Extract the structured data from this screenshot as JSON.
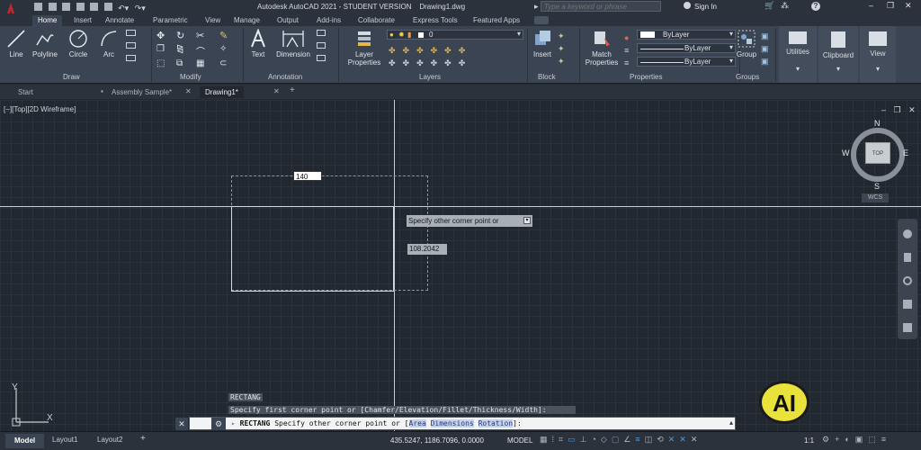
{
  "titlebar": {
    "title": "Autodesk AutoCAD 2021 - STUDENT VERSION    Drawing1.dwg",
    "search_placeholder": "Type a keyword or phrase",
    "sign_in": "Sign In"
  },
  "ribbon_tabs": [
    "Home",
    "Insert",
    "Annotate",
    "Parametric",
    "View",
    "Manage",
    "Output",
    "Add-ins",
    "Collaborate",
    "Express Tools",
    "Featured Apps"
  ],
  "draw": {
    "line": "Line",
    "polyline": "Polyline",
    "circle": "Circle",
    "arc": "Arc",
    "panel": "Draw"
  },
  "modify": {
    "panel": "Modify"
  },
  "annotation": {
    "text": "Text",
    "dimension": "Dimension",
    "panel": "Annotation"
  },
  "layers": {
    "layer_properties_1": "Layer",
    "layer_properties_2": "Properties",
    "current_layer": "0",
    "panel": "Layers"
  },
  "block": {
    "insert": "Insert",
    "panel": "Block"
  },
  "properties": {
    "match_1": "Match",
    "match_2": "Properties",
    "color": "ByLayer",
    "linetype": "ByLayer",
    "lineweight": "ByLayer",
    "panel": "Properties"
  },
  "groups": {
    "group": "Group",
    "panel": "Groups"
  },
  "utilities": {
    "label": "Utilities"
  },
  "clipboard": {
    "label": "Clipboard"
  },
  "view": {
    "label": "View"
  },
  "doc_tabs": [
    "Start",
    "Assembly Sample*",
    "Drawing1*"
  ],
  "viewport": {
    "label": "[−][Top][2D Wireframe]",
    "viewcube_top": "TOP",
    "compass_n": "N",
    "compass_s": "S",
    "compass_e": "E",
    "compass_w": "W",
    "wcs": "WCS",
    "dyn_input_width": "140",
    "tooltip": "Specify other corner point or",
    "dyn_input_height": "108.2042",
    "ucs_x": "X",
    "ucs_y": "Y"
  },
  "command": {
    "history_1": "RECTANG",
    "history_2": "Specify first corner point or [Chamfer/Elevation/Fillet/Thickness/Width]:",
    "prompt_cmd": "RECTANG",
    "prompt_text": "Specify other corner point or [",
    "opt_area": "Area",
    "opt_dimensions": "Dimensions",
    "opt_rotation": "Rotation",
    "prompt_end": "]:"
  },
  "status": {
    "tabs": [
      "Model",
      "Layout1",
      "Layout2"
    ],
    "coords": "435.5247, 1186.7096, 0.0000",
    "model": "MODEL",
    "scale": "1:1"
  },
  "logo_text": "AI",
  "colors": {
    "accent": "#c1272d",
    "active_tab": "#3b4452",
    "badge": "#e8e23a"
  }
}
